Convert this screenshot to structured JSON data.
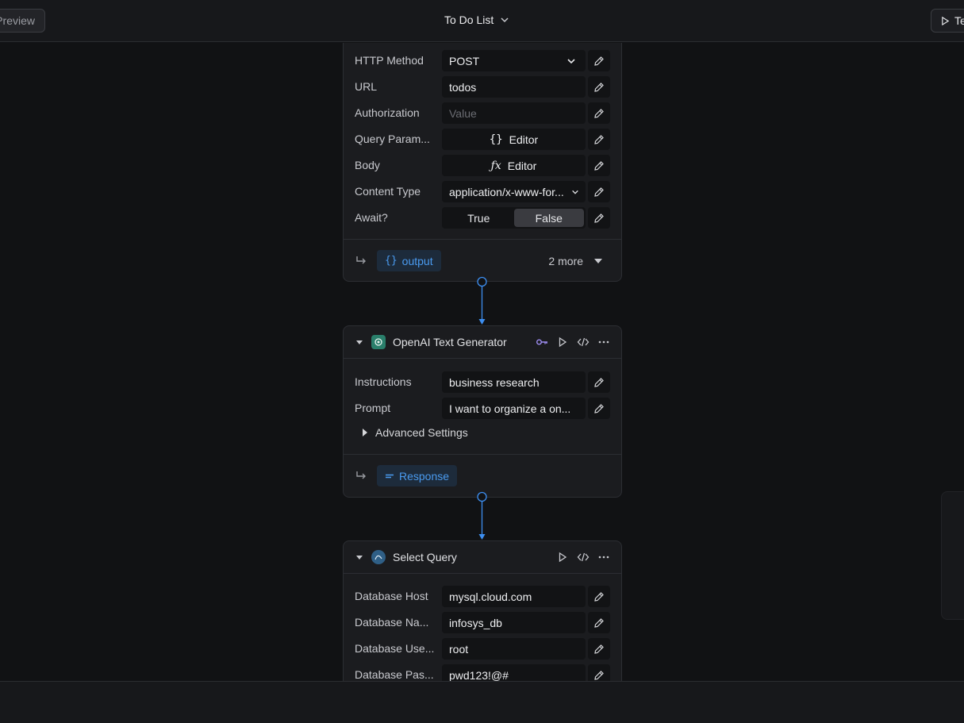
{
  "topbar": {
    "preview_label": "Preview",
    "title": "To Do List",
    "test_label": "Test"
  },
  "http_card": {
    "rows": [
      {
        "label": "HTTP Method",
        "value": "POST"
      },
      {
        "label": "URL",
        "value": "todos"
      },
      {
        "label": "Authorization",
        "placeholder": "Value"
      },
      {
        "label": "Query Param...",
        "value": "Editor"
      },
      {
        "label": "Body",
        "value": "Editor"
      },
      {
        "label": "Content Type",
        "value": "application/x-www-for..."
      },
      {
        "label": "Await?",
        "options": [
          "True",
          "False"
        ],
        "selected": "False"
      }
    ],
    "output_chip": "output",
    "more_label": "2 more"
  },
  "openai_card": {
    "title": "OpenAI Text Generator",
    "rows": [
      {
        "label": "Instructions",
        "value": "business research"
      },
      {
        "label": "Prompt",
        "value": "I want to organize a on..."
      }
    ],
    "advanced_label": "Advanced Settings",
    "output_chip": "Response"
  },
  "select_card": {
    "title": "Select Query",
    "rows": [
      {
        "label": "Database Host",
        "value": "mysql.cloud.com"
      },
      {
        "label": "Database Na...",
        "value": "infosys_db"
      },
      {
        "label": "Database Use...",
        "value": "root"
      },
      {
        "label": "Database Pas...",
        "value": "pwd123!@#"
      }
    ]
  },
  "colors": {
    "accent": "#3d8ef0",
    "background": "#111214",
    "card": "#1b1c1f",
    "chip_text": "#4a9bf0"
  },
  "icons": [
    "chevron-down-icon",
    "play-icon",
    "pencil-icon",
    "braces-icon",
    "fx-icon",
    "return-arrow-icon",
    "key-icon",
    "code-icon",
    "more-icon",
    "openai-icon",
    "mysql-icon",
    "lines-icon"
  ]
}
